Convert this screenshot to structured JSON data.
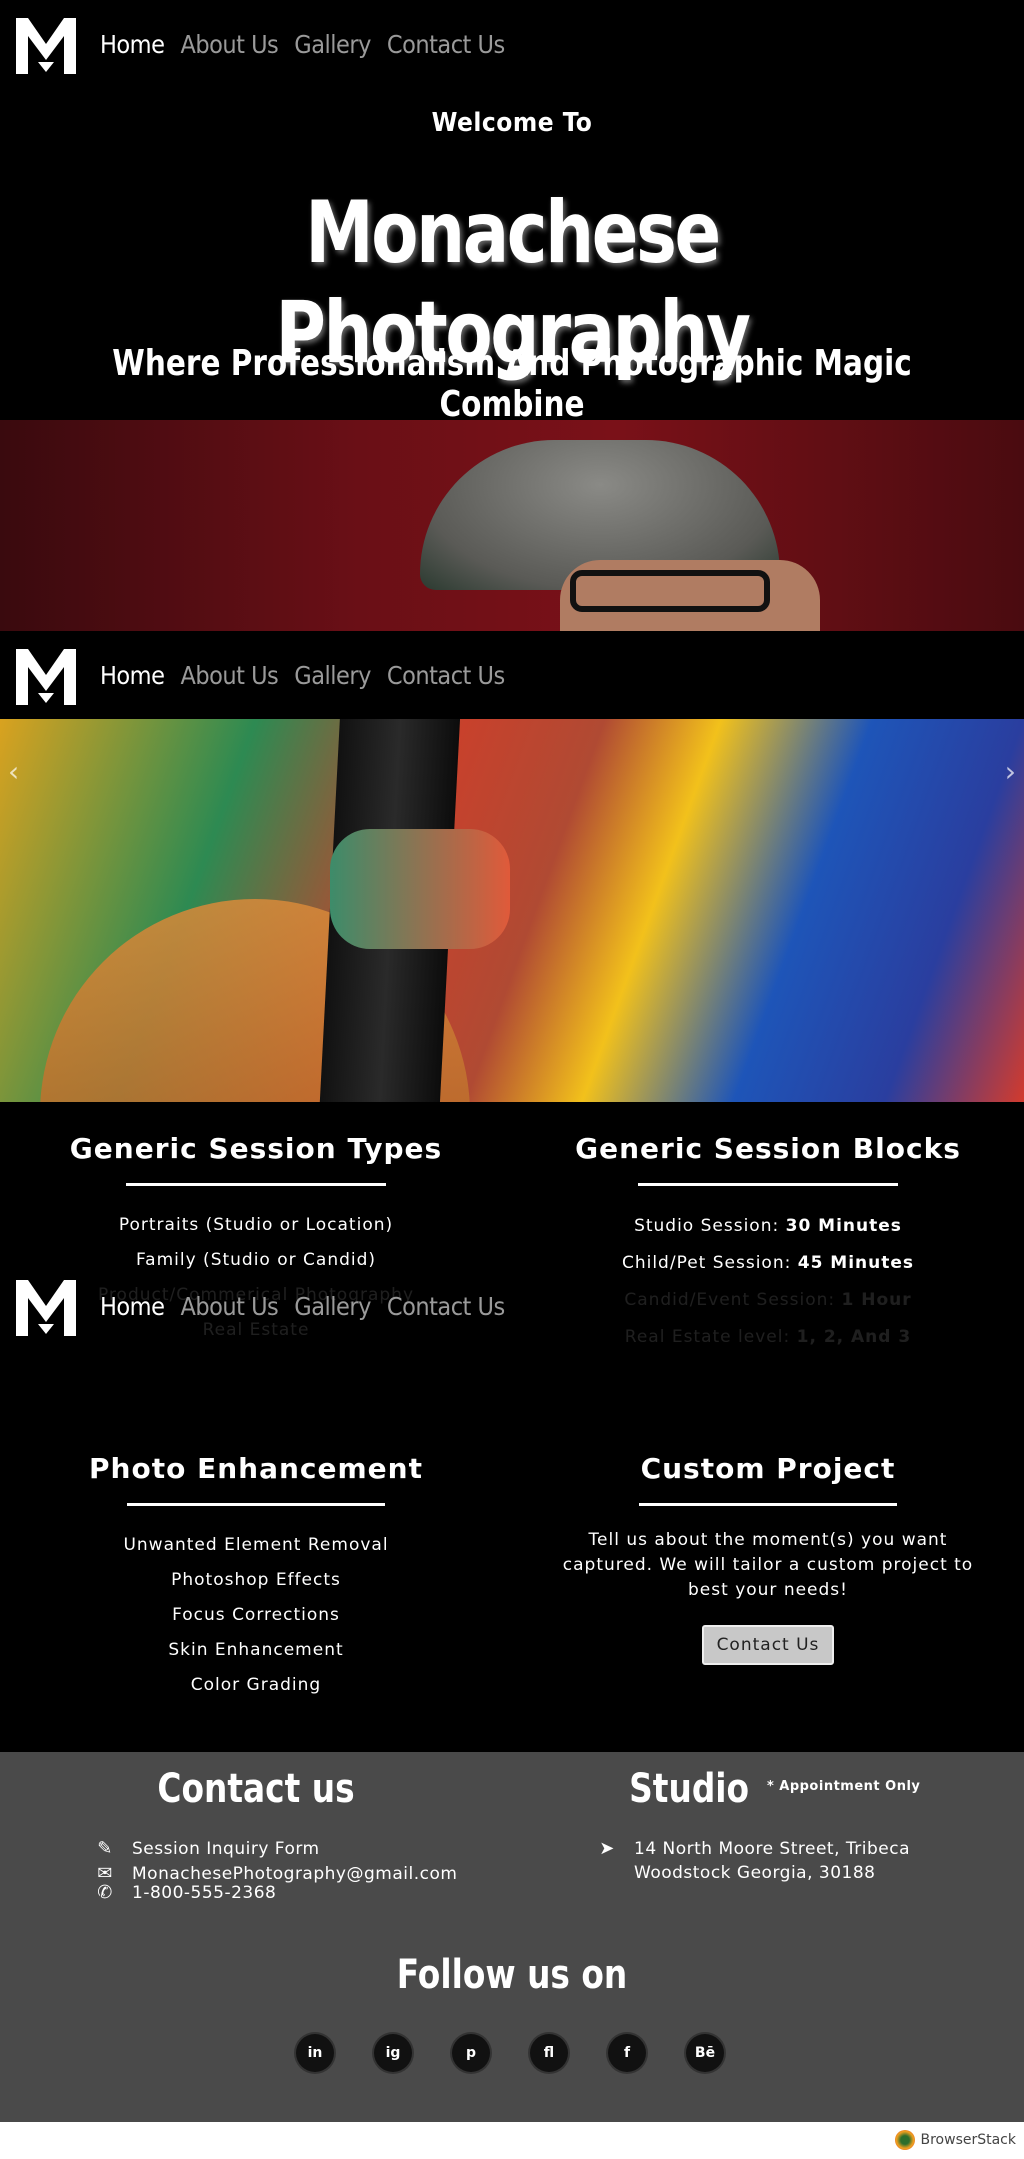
{
  "nav": {
    "items": [
      "Home",
      "About Us",
      "Gallery",
      "Contact Us"
    ]
  },
  "hero": {
    "welcome": "Welcome To",
    "title": "Monachese Photography",
    "subtitle": "Where Professionalism And Photographic Magic Combine"
  },
  "session_types": {
    "heading": "Generic Session Types",
    "items": [
      "Portraits (Studio or Location)",
      "Family (Studio or Candid)",
      "Product/Commerical Photography",
      "Real Estate"
    ]
  },
  "session_blocks": {
    "heading": "Generic Session Blocks",
    "items": [
      {
        "label": "Studio Session:",
        "value": "30 Minutes"
      },
      {
        "label": "Child/Pet Session:",
        "value": "45 Minutes"
      },
      {
        "label": "Candid/Event Session:",
        "value": "1 Hour"
      },
      {
        "label": "Real Estate level:",
        "value": "1, 2, And 3"
      }
    ]
  },
  "enhancement": {
    "heading": "Photo Enhancement",
    "items": [
      "Unwanted Element Removal",
      "Photoshop Effects",
      "Focus Corrections",
      "Skin Enhancement",
      "Color Grading"
    ]
  },
  "custom": {
    "heading": "Custom Project",
    "text": "Tell us about the moment(s) you want captured. We will tailor a custom project to best your needs!",
    "button": "Contact Us"
  },
  "footer": {
    "contact_heading": "Contact us",
    "inquiry": "Session Inquiry Form",
    "email": "MonachesePhotography@gmail.com",
    "phone": "1-800-555-2368",
    "studio_heading": "Studio",
    "studio_note": "* Appointment Only",
    "address_line1": "14 North Moore Street, Tribeca",
    "address_line2": "Woodstock Georgia, 30188",
    "follow": "Follow us on",
    "socials": [
      "in",
      "ig",
      "p",
      "fl",
      "f",
      "Bē"
    ]
  },
  "badge": "BrowserStack"
}
